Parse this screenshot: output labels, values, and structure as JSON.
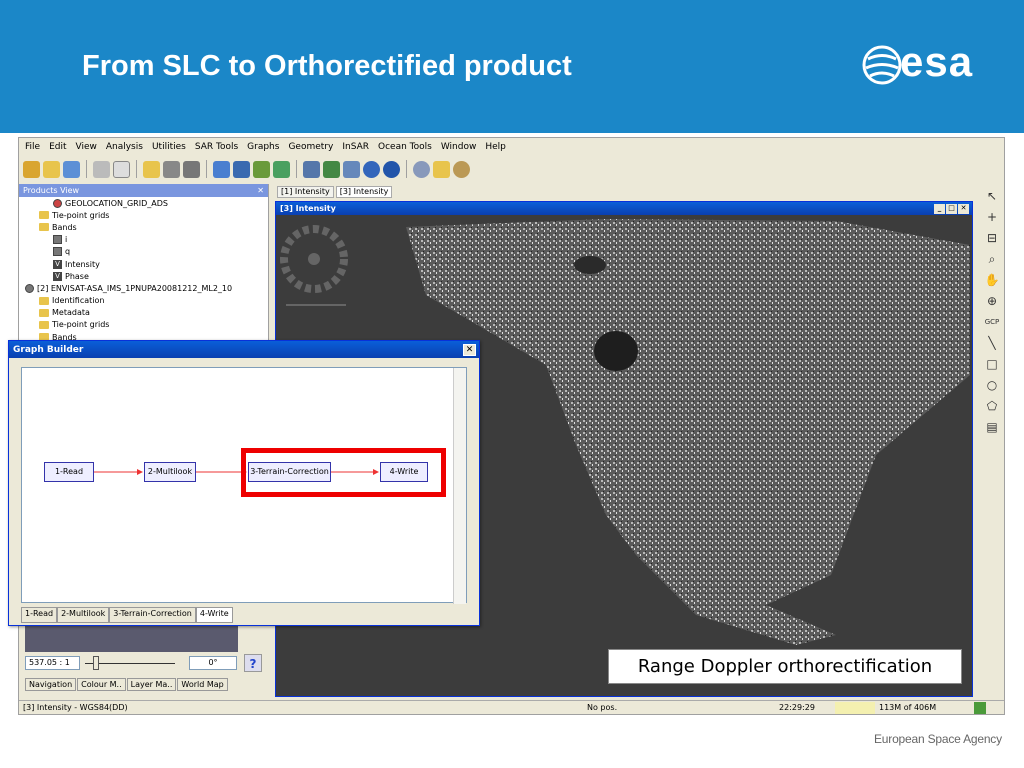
{
  "slide": {
    "title": "From SLC to Orthorectified product",
    "logo_text": "esa",
    "footer": "European Space Agency",
    "caption": "Range Doppler orthorectification",
    "header_color": "#1b87c8"
  },
  "menu": [
    "File",
    "Edit",
    "View",
    "Analysis",
    "Utilities",
    "SAR Tools",
    "Graphs",
    "Geometry",
    "InSAR",
    "Ocean Tools",
    "Window",
    "Help"
  ],
  "products_view": {
    "title": "Products View",
    "tree": [
      {
        "indent": 2,
        "type": "ex",
        "label": "GEOLOCATION_GRID_ADS"
      },
      {
        "indent": 1,
        "type": "folder",
        "label": "Tie-point grids"
      },
      {
        "indent": 1,
        "type": "folder",
        "label": "Bands"
      },
      {
        "indent": 2,
        "type": "band",
        "label": "i"
      },
      {
        "indent": 2,
        "type": "band",
        "label": "q"
      },
      {
        "indent": 2,
        "type": "vband",
        "label": "Intensity"
      },
      {
        "indent": 2,
        "type": "vband",
        "label": "Phase"
      },
      {
        "indent": 0,
        "type": "product",
        "label": "[2] ENVISAT-ASA_IMS_1PNUPA20081212_ML2_10"
      },
      {
        "indent": 1,
        "type": "folder",
        "label": "Identification"
      },
      {
        "indent": 1,
        "type": "folder",
        "label": "Metadata"
      },
      {
        "indent": 1,
        "type": "folder",
        "label": "Tie-point grids"
      },
      {
        "indent": 1,
        "type": "folder",
        "label": "Bands"
      }
    ]
  },
  "graph_builder": {
    "title": "Graph Builder",
    "nodes": [
      "1-Read",
      "2-Multilook",
      "3-Terrain-Correction",
      "4-Write"
    ],
    "tabs": [
      "1-Read",
      "2-Multilook",
      "3-Terrain-Correction",
      "4-Write"
    ]
  },
  "view": {
    "tabs": [
      "[1] Intensity",
      "[3] Intensity"
    ],
    "window_title": "[3] Intensity"
  },
  "navigation": {
    "zoom": "537.05 : 1",
    "rotation": "0°",
    "help": "?",
    "tabs": [
      "Navigation",
      "Colour M..",
      "Layer Ma..",
      "World Map"
    ]
  },
  "status": {
    "layer": "[3] Intensity - WGS84(DD)",
    "position": "No pos.",
    "time": "22:29:29",
    "memory": "113M of 406M"
  },
  "right_tools": [
    "cursor",
    "crosshair",
    "range",
    "zoom",
    "pan",
    "zoom-plus",
    "GCP",
    "line",
    "rectangle",
    "ellipse",
    "polygon",
    "layer"
  ]
}
